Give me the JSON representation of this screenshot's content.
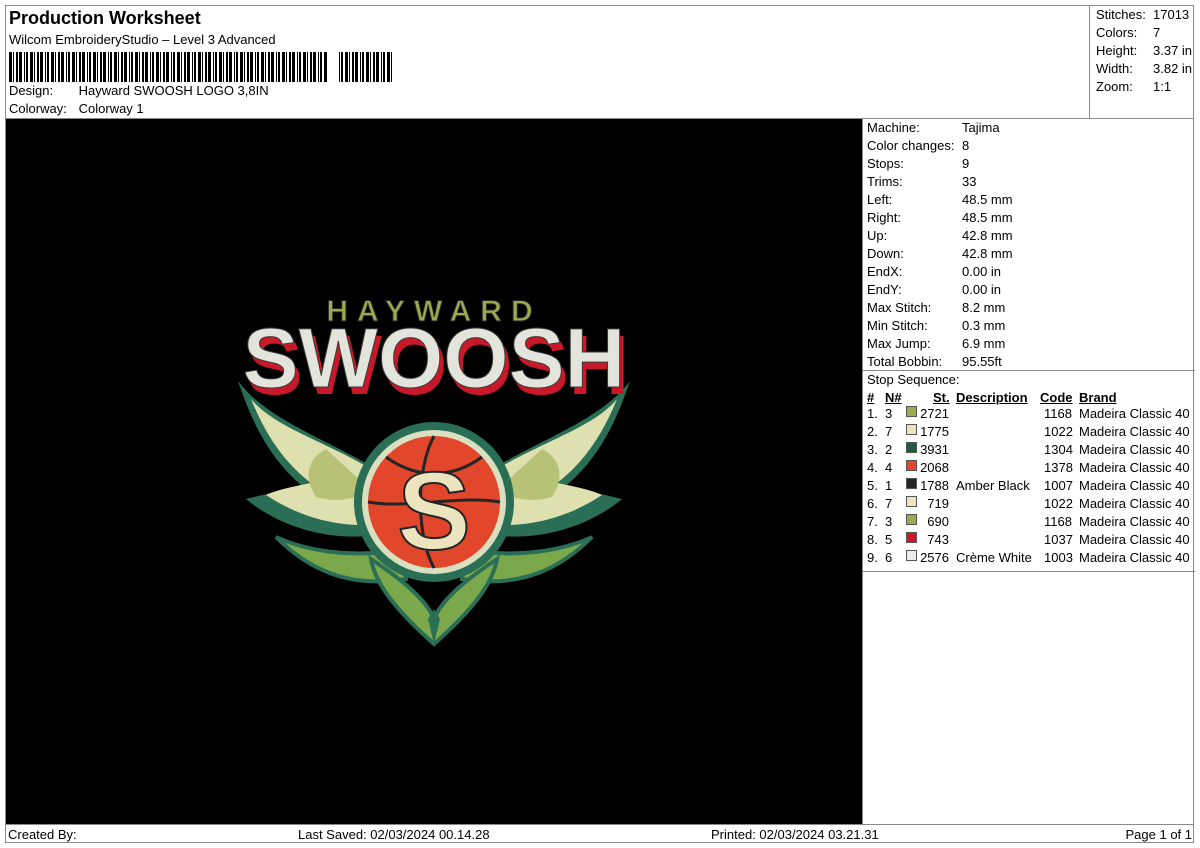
{
  "header": {
    "title": "Production Worksheet",
    "subtitle": "Wilcom EmbroideryStudio – Level 3 Advanced",
    "design_label": "Design:",
    "design_value": "Hayward SWOOSH LOGO 3,8IN",
    "colorway_label": "Colorway:",
    "colorway_value": "Colorway 1"
  },
  "stats": [
    {
      "k": "Stitches:",
      "v": "17013"
    },
    {
      "k": "Colors:",
      "v": "7"
    },
    {
      "k": "Height:",
      "v": "3.37 in"
    },
    {
      "k": "Width:",
      "v": "3.82 in"
    },
    {
      "k": "Zoom:",
      "v": "1:1"
    }
  ],
  "machine_info": [
    {
      "k": "Machine:",
      "v": "Tajima"
    },
    {
      "k": "Color changes:",
      "v": "8"
    },
    {
      "k": "Stops:",
      "v": "9"
    },
    {
      "k": "Trims:",
      "v": "33"
    },
    {
      "k": "Left:",
      "v": "48.5 mm"
    },
    {
      "k": "Right:",
      "v": "48.5 mm"
    },
    {
      "k": "Up:",
      "v": "42.8 mm"
    },
    {
      "k": "Down:",
      "v": "42.8 mm"
    },
    {
      "k": "EndX:",
      "v": "0.00 in"
    },
    {
      "k": "EndY:",
      "v": "0.00 in"
    },
    {
      "k": "Max Stitch:",
      "v": "8.2 mm"
    },
    {
      "k": "Min Stitch:",
      "v": "0.3 mm"
    },
    {
      "k": "Max Jump:",
      "v": "6.9 mm"
    },
    {
      "k": "Total Bobbin:",
      "v": "95.55ft"
    }
  ],
  "stop_sequence": {
    "title": "Stop Sequence:",
    "headers": {
      "num": "#",
      "n": "N#",
      "st": "St.",
      "desc": "Description",
      "code": "Code",
      "brand": "Brand"
    },
    "rows": [
      {
        "num": "1.",
        "n": "3",
        "color": "#9aaa4e",
        "st": "2721",
        "desc": "",
        "code": "1168",
        "brand": "Madeira Classic 40"
      },
      {
        "num": "2.",
        "n": "7",
        "color": "#ece3bf",
        "st": "1775",
        "desc": "",
        "code": "1022",
        "brand": "Madeira Classic 40"
      },
      {
        "num": "3.",
        "n": "2",
        "color": "#1f5a4a",
        "st": "3931",
        "desc": "",
        "code": "1304",
        "brand": "Madeira Classic 40"
      },
      {
        "num": "4.",
        "n": "4",
        "color": "#e2472b",
        "st": "2068",
        "desc": "",
        "code": "1378",
        "brand": "Madeira Classic 40"
      },
      {
        "num": "5.",
        "n": "1",
        "color": "#252525",
        "st": "1788",
        "desc": "Amber Black",
        "code": "1007",
        "brand": "Madeira Classic 40"
      },
      {
        "num": "6.",
        "n": "7",
        "color": "#ece3bf",
        "st": "719",
        "desc": "",
        "code": "1022",
        "brand": "Madeira Classic 40"
      },
      {
        "num": "7.",
        "n": "3",
        "color": "#9aaa4e",
        "st": "690",
        "desc": "",
        "code": "1168",
        "brand": "Madeira Classic 40"
      },
      {
        "num": "8.",
        "n": "5",
        "color": "#c9182a",
        "st": "743",
        "desc": "",
        "code": "1037",
        "brand": "Madeira Classic 40"
      },
      {
        "num": "9.",
        "n": "6",
        "color": "#eceeea",
        "st": "2576",
        "desc": "Crème White",
        "code": "1003",
        "brand": "Madeira Classic 40"
      }
    ]
  },
  "logo": {
    "top_text": "HAYWARD",
    "main_text": "SWOOSH",
    "center_letter": "S"
  },
  "footer": {
    "created": "Created By:",
    "saved": "Last Saved: 02/03/2024 00.14.28",
    "printed": "Printed: 02/03/2024 03.21.31",
    "page": "Page 1 of 1"
  }
}
